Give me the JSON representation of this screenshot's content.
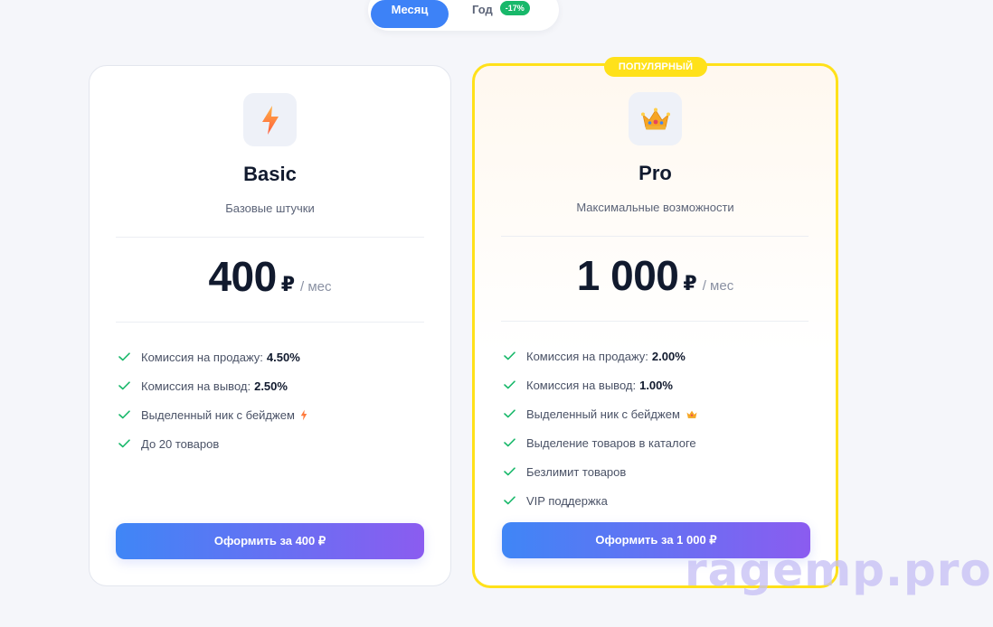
{
  "billing_toggle": {
    "month_label": "Месяц",
    "year_label": "Год",
    "year_discount": "-17%",
    "selected": "month"
  },
  "plans": [
    {
      "name": "Basic",
      "subtitle": "Базовые штучки",
      "icon": "lightning-bolt-icon",
      "price": "400",
      "currency": "₽",
      "period": "/ мес",
      "features": [
        {
          "text": "Комиссия на продажу:",
          "value": "4.50%"
        },
        {
          "text": "Комиссия на вывод:",
          "value": "2.50%"
        },
        {
          "text": "Выделенный ник с бейджем",
          "icon": "lightning-bolt-icon"
        },
        {
          "text": "До 20 товаров"
        }
      ],
      "cta_label": "Оформить за  400 ₽"
    },
    {
      "name": "Pro",
      "subtitle": "Максимальные возможности",
      "icon": "crown-icon",
      "badge": "ПОПУЛЯРНЫЙ",
      "price": "1 000",
      "currency": "₽",
      "period": "/ мес",
      "features": [
        {
          "text": "Комиссия на продажу:",
          "value": "2.00%"
        },
        {
          "text": "Комиссия на вывод:",
          "value": "1.00%"
        },
        {
          "text": "Выделенный ник с бейджем",
          "icon": "crown-icon"
        },
        {
          "text": "Выделение товаров в каталоге"
        },
        {
          "text": "Безлимит товаров"
        },
        {
          "text": "VIP поддержка"
        }
      ],
      "cta_label": "Оформить за  1 000 ₽"
    }
  ],
  "watermark": "ragemp.pro",
  "colors": {
    "accent_blue": "#3d82f7",
    "accent_purple": "#8b5cf0",
    "popular_yellow": "#ffe11a",
    "check_green": "#18b86a",
    "discount_green": "#18b86a"
  }
}
